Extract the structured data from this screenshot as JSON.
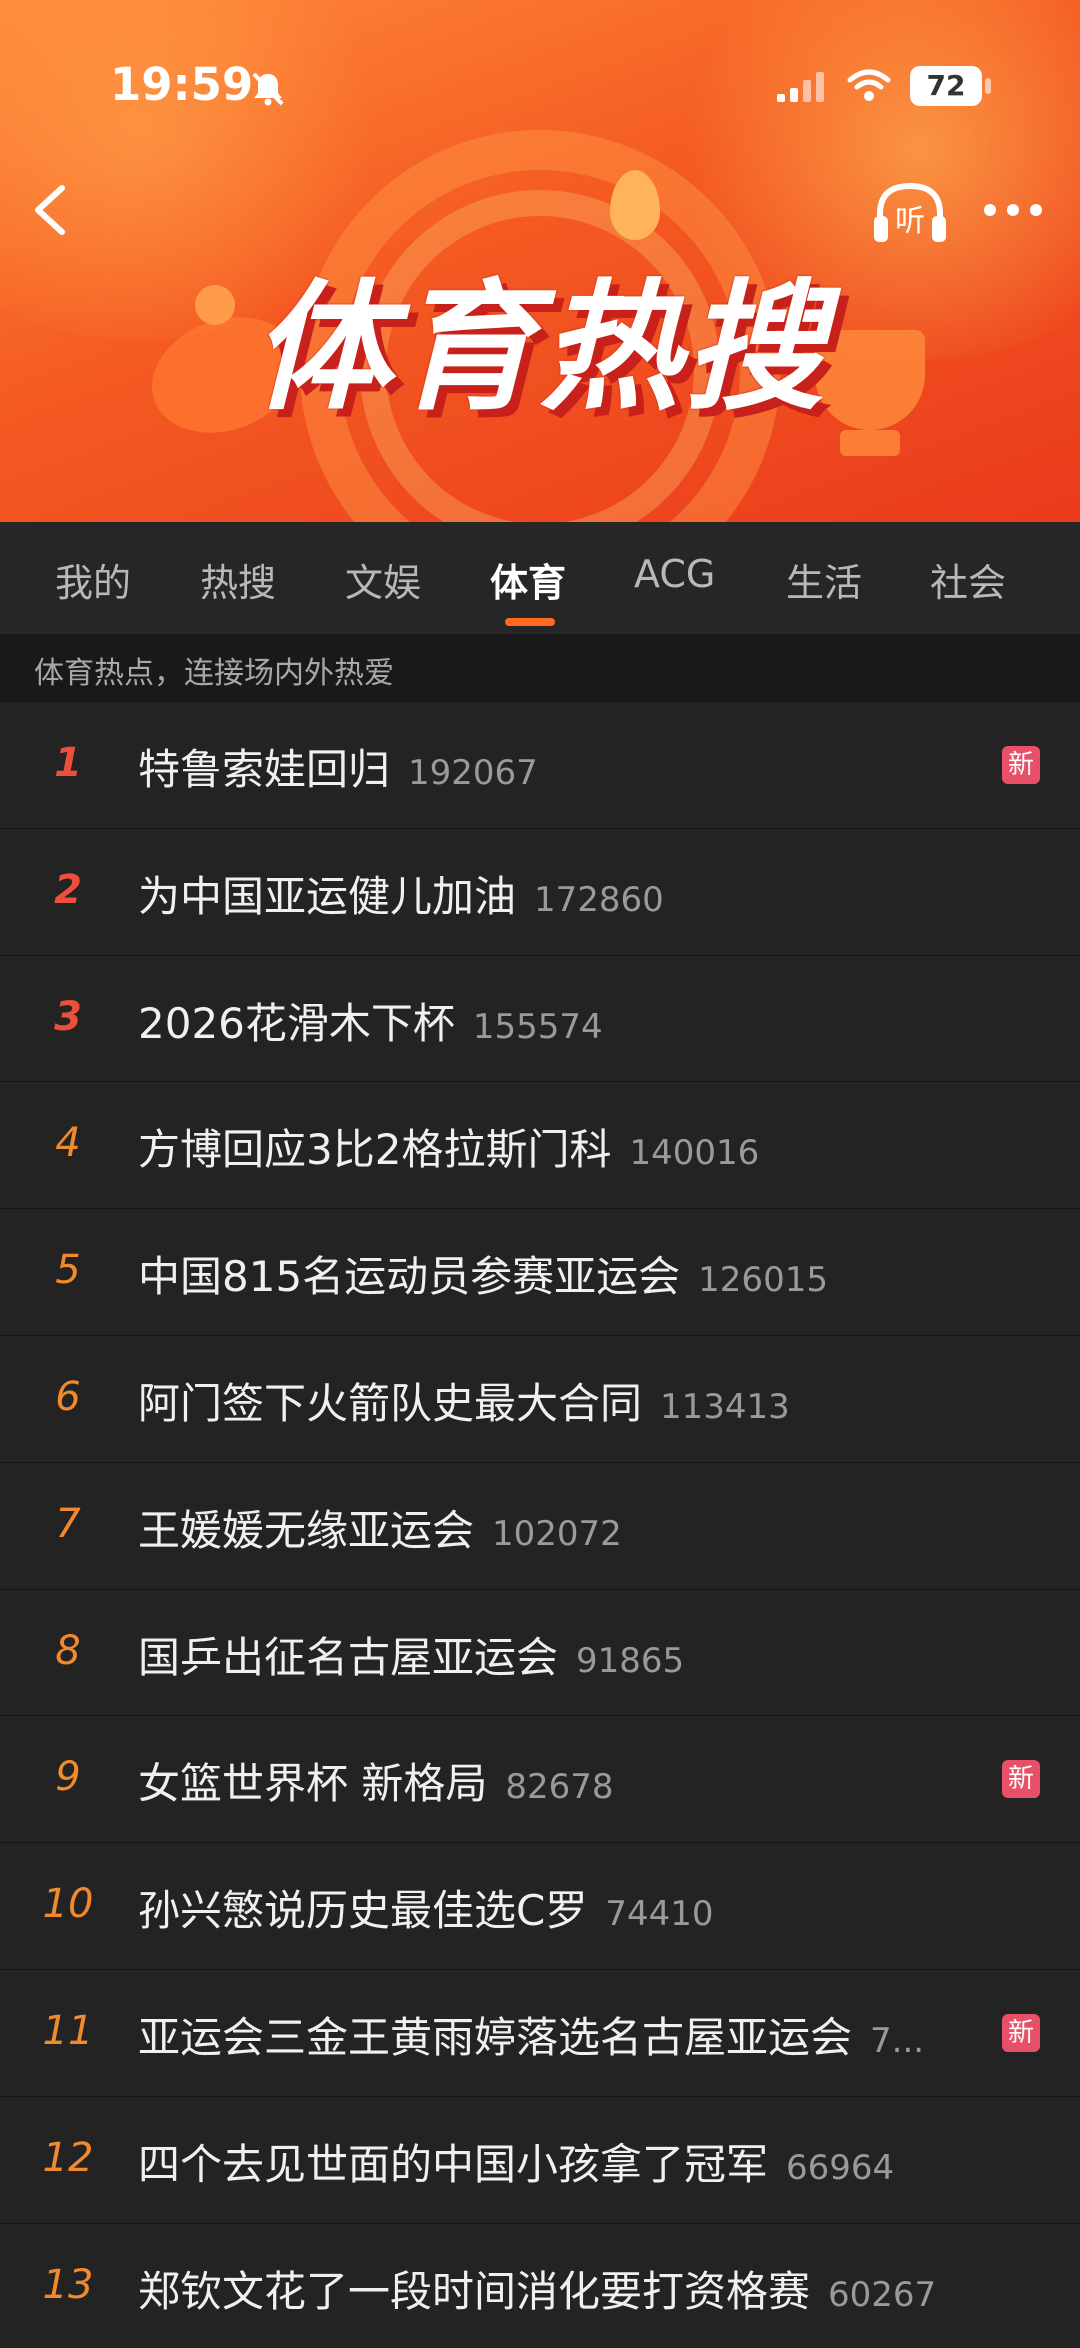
{
  "status_bar": {
    "time": "19:59",
    "battery": "72"
  },
  "header": {
    "title": "体育热搜",
    "listen_label": "听"
  },
  "tabs": [
    {
      "label": "我的"
    },
    {
      "label": "热搜"
    },
    {
      "label": "文娱"
    },
    {
      "label": "体育",
      "active": true
    },
    {
      "label": "ACG"
    },
    {
      "label": "生活"
    },
    {
      "label": "社会"
    }
  ],
  "subtitle": "体育热点，连接场内外热爱",
  "items": [
    {
      "rank": "1",
      "title": "特鲁索娃回归",
      "count": "192067",
      "badge": "新"
    },
    {
      "rank": "2",
      "title": "为中国亚运健儿加油",
      "count": "172860",
      "badge": ""
    },
    {
      "rank": "3",
      "title": "2026花滑木下杯",
      "count": "155574",
      "badge": ""
    },
    {
      "rank": "4",
      "title": "方博回应3比2格拉斯门科",
      "count": "140016",
      "badge": ""
    },
    {
      "rank": "5",
      "title": "中国815名运动员参赛亚运会",
      "count": "126015",
      "badge": ""
    },
    {
      "rank": "6",
      "title": "阿门签下火箭队史最大合同",
      "count": "113413",
      "badge": ""
    },
    {
      "rank": "7",
      "title": "王媛媛无缘亚运会",
      "count": "102072",
      "badge": ""
    },
    {
      "rank": "8",
      "title": "国乒出征名古屋亚运会",
      "count": "91865",
      "badge": ""
    },
    {
      "rank": "9",
      "title": "女篮世界杯 新格局",
      "count": "82678",
      "badge": "新"
    },
    {
      "rank": "10",
      "title": "孙兴慜说历史最佳选C罗",
      "count": "74410",
      "badge": ""
    },
    {
      "rank": "11",
      "title": "亚运会三金王黄雨婷落选名古屋亚运会",
      "count": "7...",
      "badge": "新"
    },
    {
      "rank": "12",
      "title": "四个去见世面的中国小孩拿了冠军",
      "count": "66964",
      "badge": ""
    },
    {
      "rank": "13",
      "title": "郑钦文花了一段时间消化要打资格赛",
      "count": "60267",
      "badge": ""
    }
  ],
  "colors": {
    "accent": "#ff6a1f",
    "badge_new": "#e8506a",
    "rank_top": "#ec4f3c",
    "rank_other": "#f08a2c"
  }
}
